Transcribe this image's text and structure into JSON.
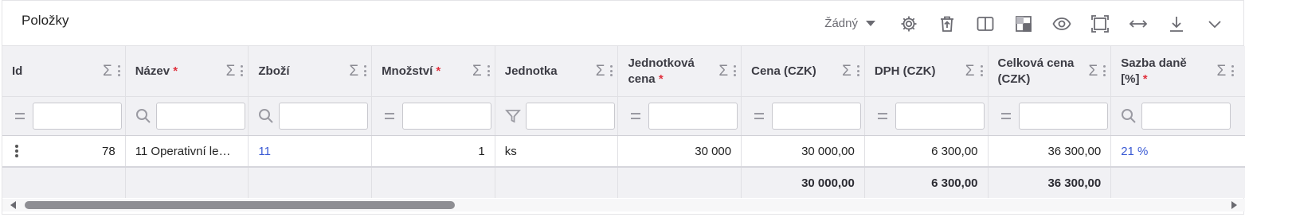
{
  "panel": {
    "title": "Položky"
  },
  "toolbar": {
    "view_select": "Žádný",
    "icons": [
      "gear-icon",
      "trash-upload-icon",
      "columns-icon",
      "checker-icon",
      "eye-icon",
      "screenshot-icon",
      "width-arrows-icon",
      "download-icon",
      "chevron-down-icon"
    ]
  },
  "columns": [
    {
      "label": "Id",
      "required": "",
      "filter_icon": "equals-icon"
    },
    {
      "label": "Název",
      "required": "*",
      "filter_icon": "search-icon"
    },
    {
      "label": "Zboží",
      "required": "",
      "filter_icon": "search-icon"
    },
    {
      "label": "Množství",
      "required": "*",
      "filter_icon": "equals-icon"
    },
    {
      "label": "Jednotka",
      "required": "",
      "filter_icon": "filter-icon"
    },
    {
      "label": "Jednotková cena",
      "required": "*",
      "filter_icon": "equals-icon"
    },
    {
      "label": "Cena (CZK)",
      "required": "",
      "filter_icon": "equals-icon"
    },
    {
      "label": "DPH (CZK)",
      "required": "",
      "filter_icon": "equals-icon"
    },
    {
      "label": "Celková cena (CZK)",
      "required": "",
      "filter_icon": "equals-icon"
    },
    {
      "label": "Sazba daně [%]",
      "required": "*",
      "filter_icon": "search-icon"
    }
  ],
  "header_sigma": "Σ",
  "rows": [
    {
      "id": "78",
      "nazev": "11 Operativní le…",
      "zbozi": "11",
      "mnozstvi": "1",
      "jednotka": "ks",
      "jednotkova_cena": "30 000",
      "cena": "30 000,00",
      "dph": "6 300,00",
      "celkova_cena": "36 300,00",
      "sazba": "21 %"
    }
  ],
  "summary": {
    "cena": "30 000,00",
    "dph": "6 300,00",
    "celkova_cena": "36 300,00"
  },
  "colors": {
    "accent": "#3b5bd4",
    "required": "#e0323e",
    "header_bg": "#f1f1f4"
  }
}
